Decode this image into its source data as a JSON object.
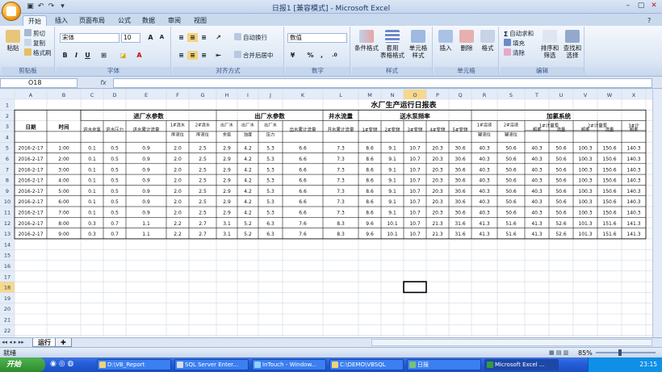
{
  "window": {
    "title": "日报1  [兼容模式] - Microsoft Excel"
  },
  "tabs": [
    "开始",
    "插入",
    "页面布局",
    "公式",
    "数据",
    "审阅",
    "视图"
  ],
  "ribbon": {
    "clipboard": {
      "label": "剪贴板",
      "paste": "粘贴",
      "cut": "剪切",
      "copy": "复制",
      "format_painter": "格式刷"
    },
    "font": {
      "label": "字体",
      "font_name": "宋体",
      "font_size": "10",
      "bold": "B",
      "italic": "I",
      "underline": "U"
    },
    "alignment": {
      "label": "对齐方式",
      "wrap": "自动换行",
      "merge": "合并后居中"
    },
    "number": {
      "label": "数字",
      "format": "数值",
      "percent": "%",
      "comma": ","
    },
    "styles": {
      "label": "样式",
      "conditional": "条件格式",
      "table": "套用\n表格格式",
      "cell": "单元格\n样式"
    },
    "cells": {
      "label": "单元格",
      "insert": "插入",
      "delete": "删除",
      "format": "格式"
    },
    "editing": {
      "label": "编辑",
      "autosum": "自动求和",
      "fill": "填充",
      "clear": "清除",
      "sort": "排序和\n筛选",
      "find": "查找和\n选择"
    }
  },
  "formula_bar": {
    "name_box": "O18",
    "fx": "fx",
    "value": ""
  },
  "sheet": {
    "columns": [
      "A",
      "B",
      "C",
      "D",
      "E",
      "F",
      "G",
      "H",
      "I",
      "J",
      "K",
      "L",
      "M",
      "N",
      "O",
      "P",
      "Q",
      "R",
      "S",
      "T",
      "U",
      "V",
      "W",
      "X"
    ],
    "selected_col": "O",
    "selected_row": 18,
    "rows": [
      1,
      2,
      3,
      4,
      5,
      6,
      7,
      8,
      9,
      10,
      11,
      12,
      13,
      14,
      15,
      16,
      17,
      18,
      19,
      20,
      21,
      22,
      23
    ],
    "title": "水厂生产运行日报表",
    "groups": [
      "进厂水参数",
      "出厂水参数",
      "井水流量",
      "送水泵频率",
      "加氯系统"
    ],
    "date_header": "日期",
    "time_header": "时间",
    "sub_headers": [
      "进水余氯",
      "进水压力",
      "进水累计流量",
      "1#清水库液位",
      "2#清水库液位",
      "出厂水余氯",
      "出厂水浊度",
      "出厂水压力",
      "出水累计流量",
      "井水累计流量",
      "1#变频",
      "2#变频",
      "3#变频",
      "4#变频",
      "5#变频",
      "1#溶液罐液位",
      "2#溶液罐液位"
    ],
    "chlorine_groups": [
      "1#计量泵",
      "2#计量泵",
      "3#计"
    ],
    "chlorine_sub": [
      "频率",
      "流量",
      "频率",
      "流量",
      "频率"
    ],
    "data_rows": [
      [
        "2016-2-17",
        "1:00",
        "0.1",
        "0.5",
        "0.9",
        "2.0",
        "2.5",
        "2.9",
        "4.2",
        "5.3",
        "6.6",
        "7.3",
        "8.6",
        "9.1",
        "10.7",
        "20.3",
        "30.6",
        "40.3",
        "50.6",
        "40.3",
        "50.6",
        "100.3",
        "150.6",
        "140.3"
      ],
      [
        "2016-2-17",
        "2:00",
        "0.1",
        "0.5",
        "0.9",
        "2.0",
        "2.5",
        "2.9",
        "4.2",
        "5.3",
        "6.6",
        "7.3",
        "8.6",
        "9.1",
        "10.7",
        "20.3",
        "30.6",
        "40.3",
        "50.6",
        "40.3",
        "50.6",
        "100.3",
        "150.6",
        "140.3"
      ],
      [
        "2016-2-17",
        "3:00",
        "0.1",
        "0.5",
        "0.9",
        "2.0",
        "2.5",
        "2.9",
        "4.2",
        "5.3",
        "6.6",
        "7.3",
        "8.6",
        "9.1",
        "10.7",
        "20.3",
        "30.6",
        "40.3",
        "50.6",
        "40.3",
        "50.6",
        "100.3",
        "150.6",
        "140.3"
      ],
      [
        "2016-2-17",
        "4:00",
        "0.1",
        "0.5",
        "0.9",
        "2.0",
        "2.5",
        "2.9",
        "4.2",
        "5.3",
        "6.6",
        "7.3",
        "8.6",
        "9.1",
        "10.7",
        "20.3",
        "30.6",
        "40.3",
        "50.6",
        "40.3",
        "50.6",
        "100.3",
        "150.6",
        "140.3"
      ],
      [
        "2016-2-17",
        "5:00",
        "0.1",
        "0.5",
        "0.9",
        "2.0",
        "2.5",
        "2.9",
        "4.2",
        "5.3",
        "6.6",
        "7.3",
        "8.6",
        "9.1",
        "10.7",
        "20.3",
        "30.6",
        "40.3",
        "50.6",
        "40.3",
        "50.6",
        "100.3",
        "150.6",
        "140.3"
      ],
      [
        "2016-2-17",
        "6:00",
        "0.1",
        "0.5",
        "0.9",
        "2.0",
        "2.5",
        "2.9",
        "4.2",
        "5.3",
        "6.6",
        "7.3",
        "8.6",
        "9.1",
        "10.7",
        "20.3",
        "30.6",
        "40.3",
        "50.6",
        "40.3",
        "50.6",
        "100.3",
        "150.6",
        "140.3"
      ],
      [
        "2016-2-17",
        "7:00",
        "0.1",
        "0.5",
        "0.9",
        "2.0",
        "2.5",
        "2.9",
        "4.2",
        "5.3",
        "6.6",
        "7.3",
        "8.6",
        "9.1",
        "10.7",
        "20.3",
        "30.6",
        "40.3",
        "50.6",
        "40.3",
        "50.6",
        "100.3",
        "150.6",
        "140.3"
      ],
      [
        "2016-2-17",
        "8:00",
        "0.3",
        "0.7",
        "1.1",
        "2.2",
        "2.7",
        "3.1",
        "5.2",
        "6.3",
        "7.6",
        "8.3",
        "9.6",
        "10.1",
        "10.7",
        "21.3",
        "31.6",
        "41.3",
        "51.6",
        "41.3",
        "52.6",
        "101.3",
        "151.6",
        "141.3"
      ],
      [
        "2016-2-17",
        "9:00",
        "0.3",
        "0.7",
        "1.1",
        "2.2",
        "2.7",
        "3.1",
        "5.2",
        "6.3",
        "7.6",
        "8.3",
        "9.6",
        "10.1",
        "10.7",
        "21.3",
        "31.6",
        "41.3",
        "51.6",
        "41.3",
        "52.6",
        "101.3",
        "151.6",
        "141.3"
      ]
    ]
  },
  "sheet_tabs": {
    "active": "运行"
  },
  "status": {
    "ready": "就绪",
    "zoom": "85%"
  },
  "taskbar": {
    "start": "开始",
    "items": [
      "D:\\VB_Report",
      "SQL Server Enter...",
      "InTouch - Window...",
      "C:\\DEMO\\VBSQL",
      "日报",
      "Microsoft Excel ..."
    ],
    "clock": "23:15"
  }
}
